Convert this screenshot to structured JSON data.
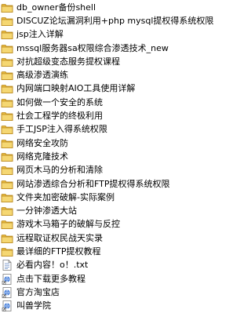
{
  "items": [
    {
      "label": "db_owner备份shell",
      "type": "folder"
    },
    {
      "label": "DISCUZ论坛漏洞利用+php mysql提权得系统权限",
      "type": "folder"
    },
    {
      "label": "jsp注入详解",
      "type": "folder"
    },
    {
      "label": "mssql服务器sa权限综合渗透技术_new",
      "type": "folder"
    },
    {
      "label": "对抗超级变态服务提权课程",
      "type": "folder"
    },
    {
      "label": "高级渗透演练",
      "type": "folder"
    },
    {
      "label": "内网端口映射AIO工具使用详解",
      "type": "folder"
    },
    {
      "label": "如何做一个安全的系统",
      "type": "folder"
    },
    {
      "label": "社会工程学的终极利用",
      "type": "folder"
    },
    {
      "label": "手工JSP注入得系统权限",
      "type": "folder"
    },
    {
      "label": "网络安全攻防",
      "type": "folder"
    },
    {
      "label": "网络克隆技术",
      "type": "folder"
    },
    {
      "label": "网页木马的分析和清除",
      "type": "folder"
    },
    {
      "label": "网站渗透综合分析和FTP提权得系统权限",
      "type": "folder"
    },
    {
      "label": "文件夹加密破解-实际案例",
      "type": "folder"
    },
    {
      "label": "一分钟渗透大站",
      "type": "folder"
    },
    {
      "label": "游戏木马箱子的破解与反控",
      "type": "folder"
    },
    {
      "label": "远程取证权民战天实录",
      "type": "folder"
    },
    {
      "label": "最详细的FTP提权教程",
      "type": "folder"
    },
    {
      "label": "必看内容！o！.txt",
      "type": "text-file"
    },
    {
      "label": "点击下载更多教程",
      "type": "web-link"
    },
    {
      "label": "官方淘宝店",
      "type": "web-link"
    },
    {
      "label": "叫兽学院",
      "type": "web-link"
    }
  ],
  "colors": {
    "folder_body": "#f5d772",
    "folder_tab": "#e7b93d",
    "folder_outline": "#b8861b",
    "link_blue": "#2f6fd6"
  }
}
